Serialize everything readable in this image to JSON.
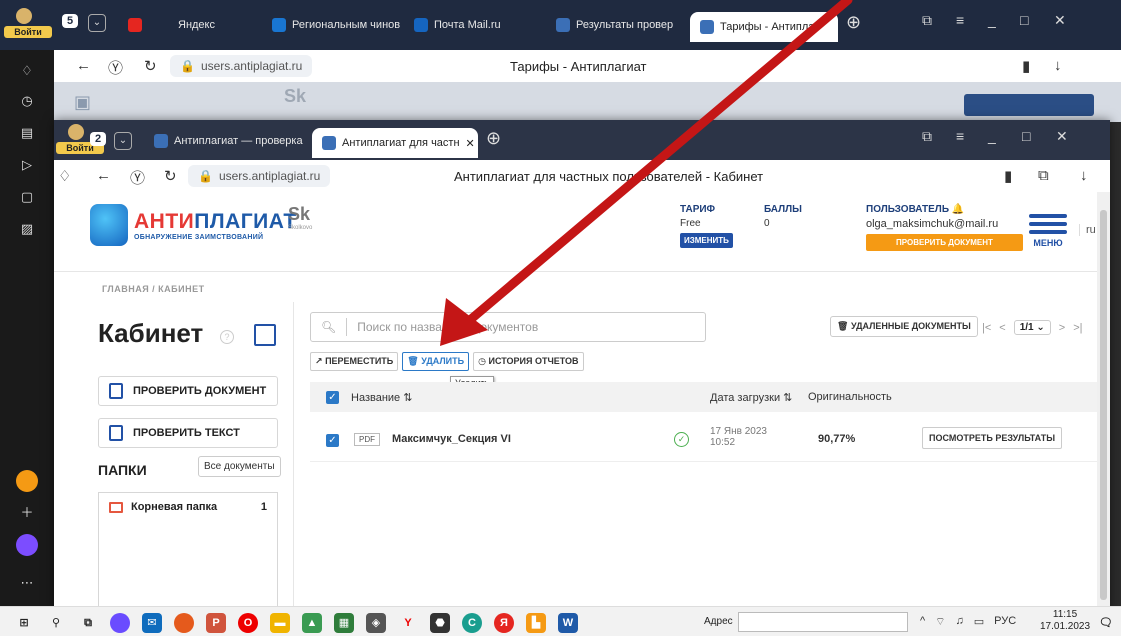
{
  "back_window": {
    "login_label": "Войти",
    "tab_count": "5",
    "tabs": [
      {
        "label": "Яндекс",
        "color": "#e52620"
      },
      {
        "label": "Региональным чинов",
        "color": "#1976d2"
      },
      {
        "label": "Почта Mail.ru",
        "color": "#1565c0"
      },
      {
        "label": "Результаты провер",
        "color": "#3b6fb6"
      },
      {
        "label": "Тарифы - Антипла",
        "color": "#3b6fb6"
      }
    ],
    "url": "users.antiplagiat.ru",
    "page_title": "Тарифы - Антиплагиат"
  },
  "front_window": {
    "login_label": "Войти",
    "tab_count": "2",
    "tabs": [
      {
        "label": "Антиплагиат — проверка"
      },
      {
        "label": "Антиплагиат для частн"
      }
    ],
    "url": "users.antiplagiat.ru",
    "page_title": "Антиплагиат для частных пользователей - Кабинет"
  },
  "site": {
    "logo_name_a": "АНТИ",
    "logo_name_b": "ПЛАГИАТ",
    "logo_sub": "ОБНАРУЖЕНИЕ ЗАИМСТВОВАНИЙ",
    "sk_logo": "Sk",
    "sk_sub": "Skolkovo",
    "tariff_label": "ТАРИФ",
    "tariff_value": "Free",
    "tariff_change": "ИЗМЕНИТЬ",
    "points_label": "БАЛЛЫ",
    "points_value": "0",
    "user_label": "ПОЛЬЗОВАТЕЛЬ",
    "user_email": "olga_maksimchuk@mail.ru",
    "check_doc_btn": "ПРОВЕРИТЬ ДОКУМЕНТ",
    "menu_label": "МЕНЮ",
    "lang": "ru",
    "breadcrumb": "ГЛАВНАЯ / КАБИНЕТ",
    "cabinet_title": "Кабинет",
    "btn_check_document": "ПРОВЕРИТЬ ДОКУМЕНТ",
    "btn_check_text": "ПРОВЕРИТЬ ТЕКСТ",
    "folders_title": "ПАПКИ",
    "all_documents": "Все документы",
    "folders": [
      {
        "name": "Корневая папка",
        "count": "1"
      }
    ],
    "search_placeholder": "Поиск по названиям документов",
    "deleted_docs": "УДАЛЕННЫЕ ДОКУМЕНТЫ",
    "pager_value": "1/1",
    "action_move": "ПЕРЕМЕСТИТЬ",
    "action_delete": "УДАЛИТЬ",
    "action_history": "ИСТОРИЯ ОТЧЕТОВ",
    "tooltip": "Удалить",
    "col_name": "Название",
    "col_date": "Дата загрузки",
    "col_originality": "Оригинальность",
    "documents": [
      {
        "type": "PDF",
        "name": "Максимчук_Секция VI",
        "date": "17 Янв 2023",
        "time": "10:52",
        "originality": "90,77%",
        "view_btn": "ПОСМОТРЕТЬ РЕЗУЛЬТАТЫ"
      }
    ]
  },
  "taskbar": {
    "address_label": "Адрес",
    "lang": "РУС",
    "time": "11:15",
    "date": "17.01.2023"
  },
  "colors": {
    "brand_blue": "#2251a6",
    "brand_orange": "#f59a14",
    "arrow_red": "#c41616"
  }
}
